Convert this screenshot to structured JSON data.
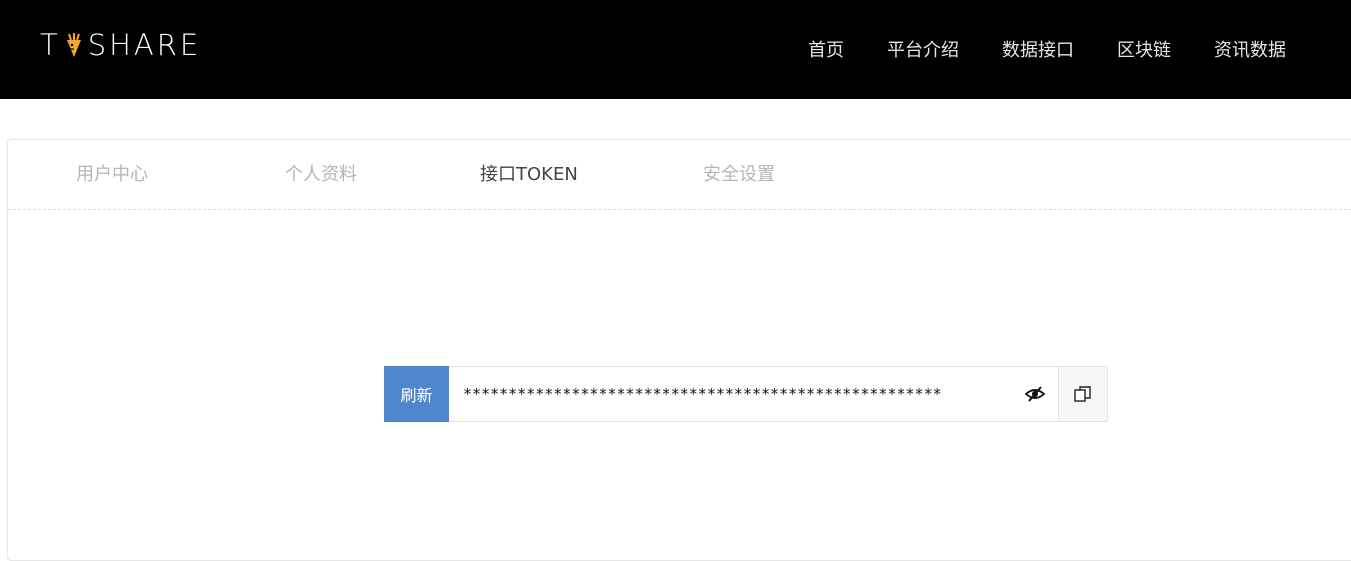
{
  "brand": {
    "name_left": "T",
    "name_right": "SHARE",
    "logo_icon": "carrot-icon",
    "accent": "#f5a623"
  },
  "nav": {
    "items": [
      {
        "label": "首页"
      },
      {
        "label": "平台介绍"
      },
      {
        "label": "数据接口"
      },
      {
        "label": "区块链"
      },
      {
        "label": "资讯数据"
      }
    ]
  },
  "tabs": [
    {
      "label": "用户中心",
      "active": false
    },
    {
      "label": "个人资料",
      "active": false
    },
    {
      "label": "接口TOKEN",
      "active": true
    },
    {
      "label": "安全设置",
      "active": false
    }
  ],
  "token": {
    "refresh_label": "刷新",
    "masked_value": "*****************************************************",
    "toggle_icon": "eye-slash-icon",
    "copy_icon": "copy-icon",
    "button_color": "#4f86cc"
  }
}
